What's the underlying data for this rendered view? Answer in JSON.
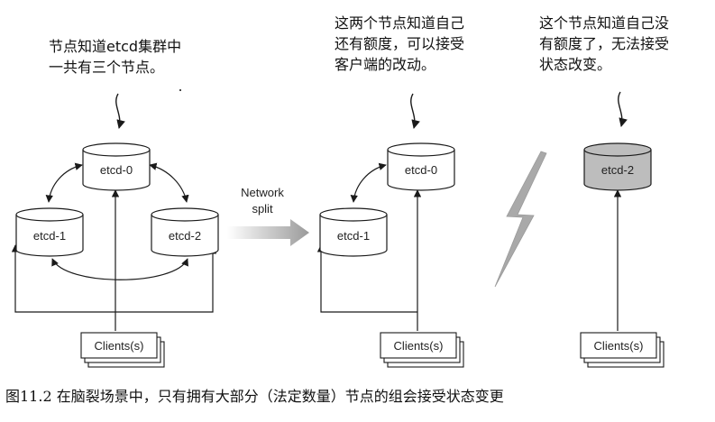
{
  "annotations": {
    "left": [
      "节点知道etcd集群中",
      "一共有三个节点。"
    ],
    "middle": [
      "这两个节点知道自己",
      "还有额度，可以接受",
      "客户端的改动。"
    ],
    "right": [
      "这个节点知道自己没",
      "有额度了，无法接受",
      "状态改变。"
    ]
  },
  "nodes": {
    "left_top": "etcd-0",
    "left_left": "etcd-1",
    "left_right": "etcd-2",
    "mid_top": "etcd-0",
    "mid_left": "etcd-1",
    "right_node": "etcd-2"
  },
  "network_split": [
    "Network",
    "split"
  ],
  "clients": {
    "left": "Clients(s)",
    "middle": "Clients(s)",
    "right": "Clients(s)"
  },
  "caption": "图11.2 在脑裂场景中，只有拥有大部分（法定数量）节点的组会接受状态变更",
  "colors": {
    "line": "#1a1a1a",
    "node_fill": "#ffffff",
    "isolated_node_fill": "#bdbdbd",
    "lightning": "#a9a9a9"
  }
}
